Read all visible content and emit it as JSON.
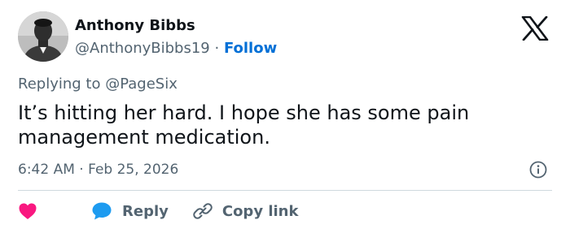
{
  "author": {
    "name": "Anthony Bibbs",
    "handle": "@AnthonyBibbs19",
    "separator": "·",
    "follow_label": "Follow"
  },
  "reply_context": {
    "prefix": "Replying to",
    "mention": "@PageSix"
  },
  "tweet": {
    "text": "It’s hitting her hard. I hope she has some pain management medication."
  },
  "meta": {
    "time": "6:42 AM",
    "separator": "·",
    "date": "Feb 25, 2026"
  },
  "actions": {
    "reply_label": "Reply",
    "copy_link_label": "Copy link"
  },
  "icons": {
    "logo": "x-logo-icon",
    "info": "info-icon",
    "like": "heart-icon",
    "reply": "speech-bubble-icon",
    "copy": "link-icon"
  },
  "colors": {
    "like": "#f91880",
    "reply": "#1d9bf0",
    "follow": "#006fd6",
    "muted": "#536471"
  }
}
